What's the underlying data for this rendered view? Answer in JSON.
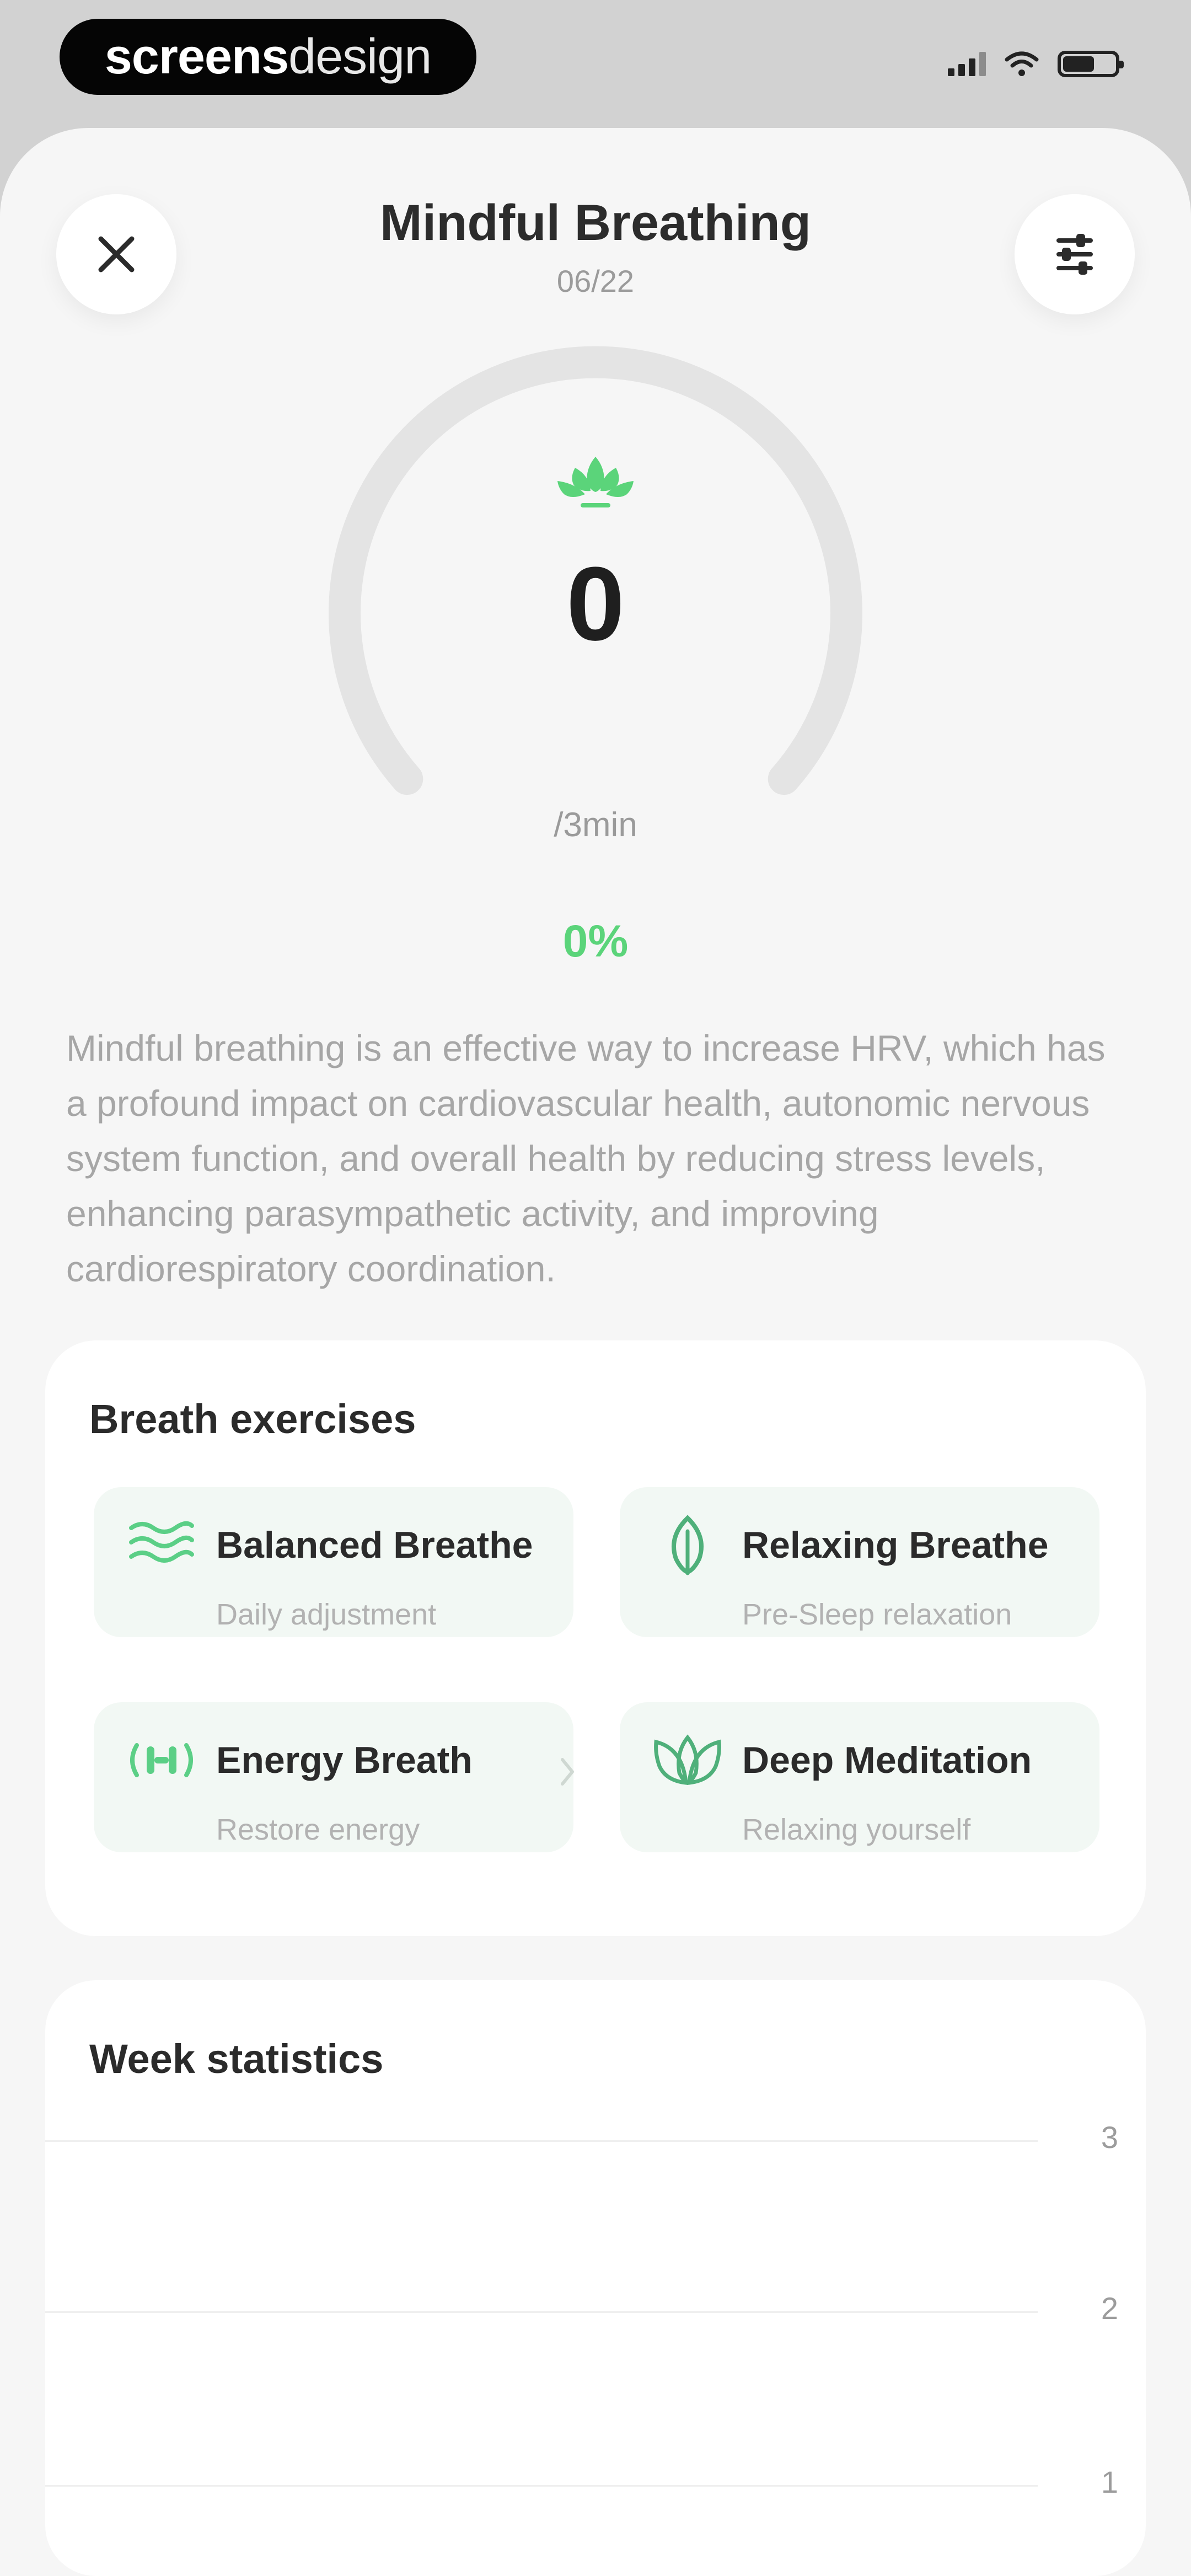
{
  "status_bar": {
    "brand_part1": "screens",
    "brand_part2": "design"
  },
  "header": {
    "title": "Mindful Breathing",
    "subtitle": "06/22"
  },
  "gauge": {
    "value": "0",
    "unit": "/3min",
    "percent_label": "0%",
    "progress_fraction": 0,
    "accent_color": "#5bd47a",
    "track_color": "#e4e4e4"
  },
  "description": "Mindful breathing is an effective way to increase HRV, which has a profound impact on cardiovascular health, autonomic nervous system function, and overall health by reducing stress levels, enhancing parasympathetic activity, and improving cardiorespiratory coordination.",
  "exercises": {
    "title": "Breath exercises",
    "items": [
      {
        "name": "Balanced Breathe",
        "subtitle": "Daily adjustment",
        "icon": "waves-icon"
      },
      {
        "name": "Relaxing Breathe",
        "subtitle": "Pre-Sleep relaxation",
        "icon": "leaf-icon"
      },
      {
        "name": "Energy Breath",
        "subtitle": "Restore energy",
        "icon": "energy-icon"
      },
      {
        "name": "Deep Meditation",
        "subtitle": "Relaxing yourself",
        "icon": "lotus-outline-icon"
      }
    ]
  },
  "stats": {
    "title": "Week statistics",
    "y_ticks": [
      "3",
      "2",
      "1"
    ]
  },
  "icons": {
    "close": "close-icon",
    "settings": "sliders-icon",
    "gauge": "lotus-icon"
  }
}
